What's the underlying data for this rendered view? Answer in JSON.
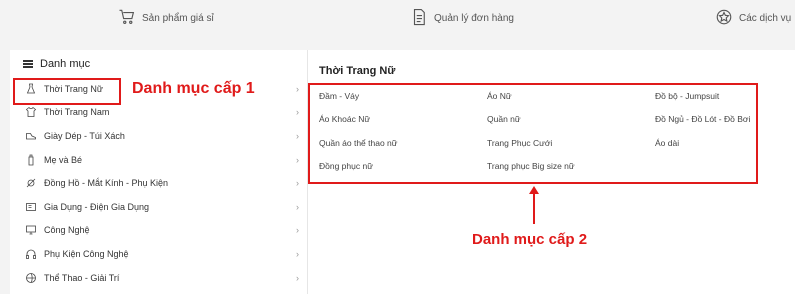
{
  "top_nav": [
    {
      "label": "Sản phẩm giá sỉ",
      "icon": "cart-icon"
    },
    {
      "label": "Quản lý đơn hàng",
      "icon": "document-icon"
    },
    {
      "label": "Các dịch vụ",
      "icon": "star-badge-icon"
    }
  ],
  "sidebar": {
    "title": "Danh mục",
    "items": [
      {
        "label": "Thời Trang Nữ",
        "icon": "dress-icon"
      },
      {
        "label": "Thời Trang Nam",
        "icon": "shirt-icon"
      },
      {
        "label": "Giày Dép - Túi Xách",
        "icon": "shoe-icon"
      },
      {
        "label": "Mẹ và Bé",
        "icon": "baby-bottle-icon"
      },
      {
        "label": "Đồng Hồ - Mắt Kính - Phụ Kiện",
        "icon": "watch-icon"
      },
      {
        "label": "Gia Dụng - Điện Gia Dụng",
        "icon": "appliance-icon"
      },
      {
        "label": "Công Nghệ",
        "icon": "monitor-icon"
      },
      {
        "label": "Phụ Kiện Công Nghệ",
        "icon": "headphones-icon"
      },
      {
        "label": "Thể Thao - Giải Trí",
        "icon": "ball-icon"
      }
    ],
    "chevron": "›"
  },
  "annotations": {
    "level1": "Danh mục cấp 1",
    "level2": "Danh mục cấp 2"
  },
  "main": {
    "title": "Thời Trang Nữ",
    "subcategories": [
      "Đầm - Váy",
      "Áo Nữ",
      "Đồ bộ - Jumpsuit",
      "Áo Khoác Nữ",
      "Quần nữ",
      "Đồ Ngủ - Đồ Lót - Đồ Bơi",
      "Quần áo thể thao nữ",
      "Trang Phục Cưới",
      "Áo dài",
      "Đồng phục nữ",
      "Trang phục Big size nữ"
    ]
  },
  "colors": {
    "accent": "#e01a1a"
  }
}
